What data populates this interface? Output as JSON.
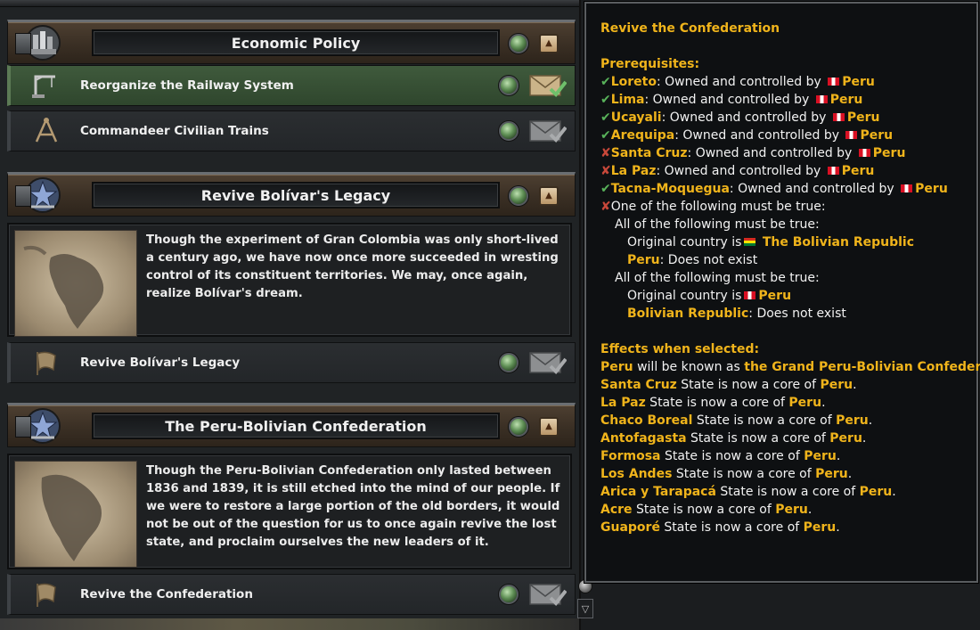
{
  "categories": [
    {
      "title": "Economic Policy",
      "decisions": [
        {
          "label": "Reorganize the Railway System"
        },
        {
          "label": "Commandeer Civilian Trains"
        }
      ]
    },
    {
      "title": "Revive Bolívar's Legacy",
      "description": "Though the experiment of Gran Colombia was only short-lived a century ago, we have now once more succeeded in wresting control of its constituent territories. We may, once again, realize Bolívar's dream.",
      "decisions": [
        {
          "label": "Revive Bolívar's Legacy"
        }
      ]
    },
    {
      "title": "The Peru-Bolivian Confederation",
      "description": "Though the Peru-Bolivian Confederation only lasted between 1836 and 1839, it is still etched into the mind of our people. If we were to restore a large portion of the old borders, it would not be out of the question for us to once again revive the lost state, and proclaim ourselves the new leaders of it.",
      "decisions": [
        {
          "label": "Revive the Confederation"
        }
      ]
    }
  ],
  "tooltip": {
    "title": "Revive the Confederation",
    "prereq_header": "Prerequisites:",
    "owned_text": ": Owned and controlled by",
    "country": "Peru",
    "states": [
      {
        "name": "Loreto",
        "met": true
      },
      {
        "name": "Lima",
        "met": true
      },
      {
        "name": "Ucayali",
        "met": true
      },
      {
        "name": "Arequipa",
        "met": true
      },
      {
        "name": "Santa Cruz",
        "met": false
      },
      {
        "name": "La Paz",
        "met": false
      },
      {
        "name": "Tacna-Moquegua",
        "met": true
      }
    ],
    "one_of": "One of the following must be true:",
    "all_of": "All of the following must be true:",
    "original_country_is": "Original country is",
    "bolivian_republic": "The Bolivian Republic",
    "bolivian_republic_short": "Bolivian Republic",
    "does_not_exist": ": Does not exist",
    "effects_header": "Effects when selected:",
    "known_as_text": "will be known as",
    "new_name": "the Grand Peru-Bolivian Confederation",
    "core_text": "State is now a core of",
    "core_states": [
      "Santa Cruz",
      "La Paz",
      "Chaco Boreal",
      "Antofagasta",
      "Formosa",
      "Los Andes",
      "Arica y Tarapacá",
      "Acre",
      "Guaporé"
    ],
    "colors": {
      "highlight": "#f0b41b",
      "ok": "#58b25a",
      "bad": "#c8483a"
    }
  }
}
